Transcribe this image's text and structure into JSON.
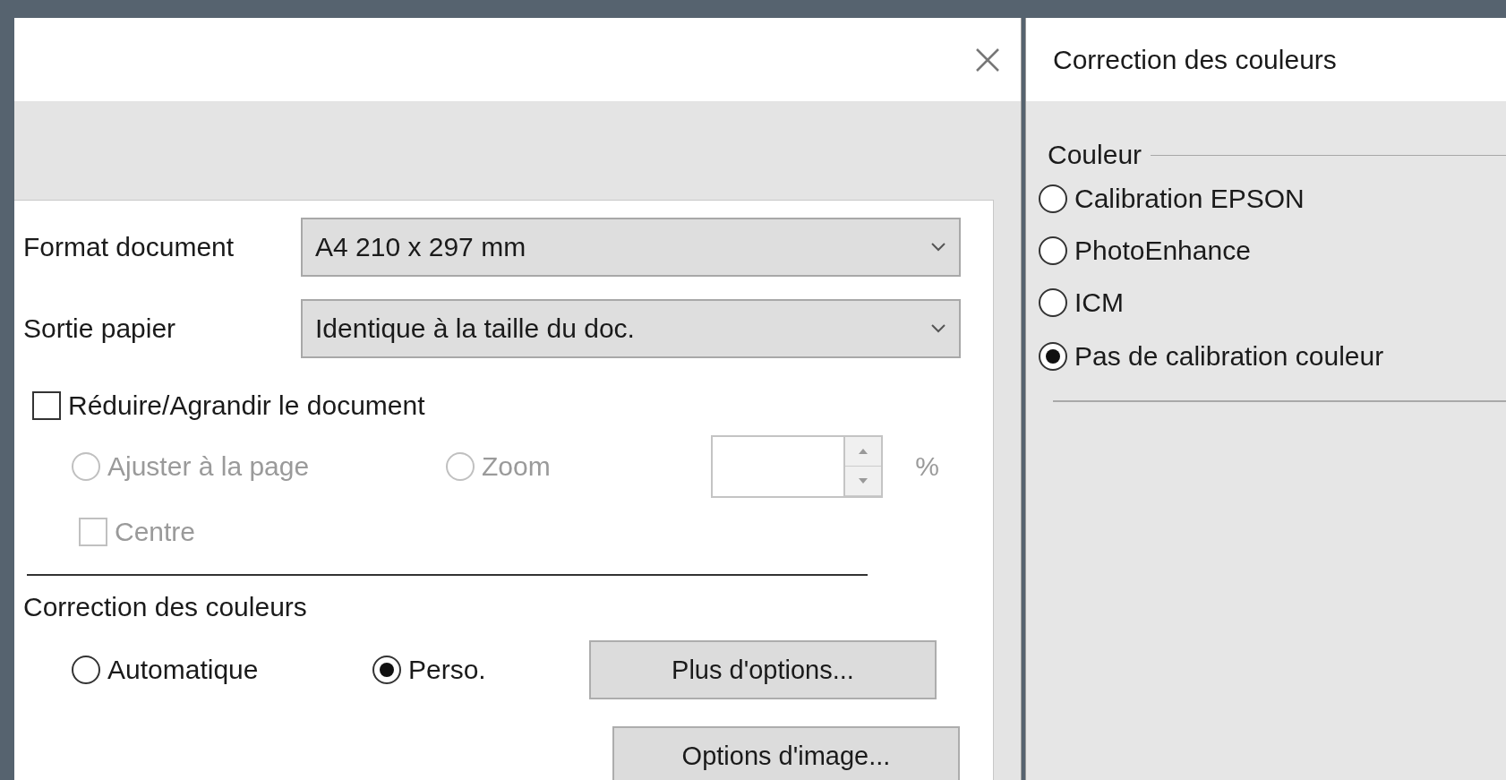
{
  "left_dialog": {
    "fields": [
      {
        "label": "Format document",
        "value": "A4 210 x 297 mm"
      },
      {
        "label": "Sortie papier",
        "value": "Identique à la taille du doc."
      }
    ],
    "resize_checkbox": {
      "label": "Réduire/Agrandir le document",
      "checked": false
    },
    "fit_options": [
      {
        "label": "Ajuster à la page",
        "selected": false,
        "disabled": true
      },
      {
        "label": "Zoom",
        "selected": false,
        "disabled": true
      }
    ],
    "zoom_field": {
      "unit": "%",
      "disabled": true
    },
    "center_checkbox": {
      "label": "Centre",
      "checked": false,
      "disabled": true
    },
    "color_correction": {
      "title": "Correction des couleurs",
      "options": [
        {
          "label": "Automatique",
          "selected": false
        },
        {
          "label": "Perso.",
          "selected": true
        }
      ]
    },
    "buttons": [
      "Plus d'options...",
      "Options d'image..."
    ]
  },
  "right_dialog": {
    "title": "Correction des couleurs",
    "group": {
      "title": "Couleur",
      "options": [
        {
          "label": "Calibration EPSON",
          "selected": false
        },
        {
          "label": "PhotoEnhance",
          "selected": false
        },
        {
          "label": "ICM",
          "selected": false
        },
        {
          "label": "Pas de calibration couleur",
          "selected": true
        }
      ]
    }
  }
}
